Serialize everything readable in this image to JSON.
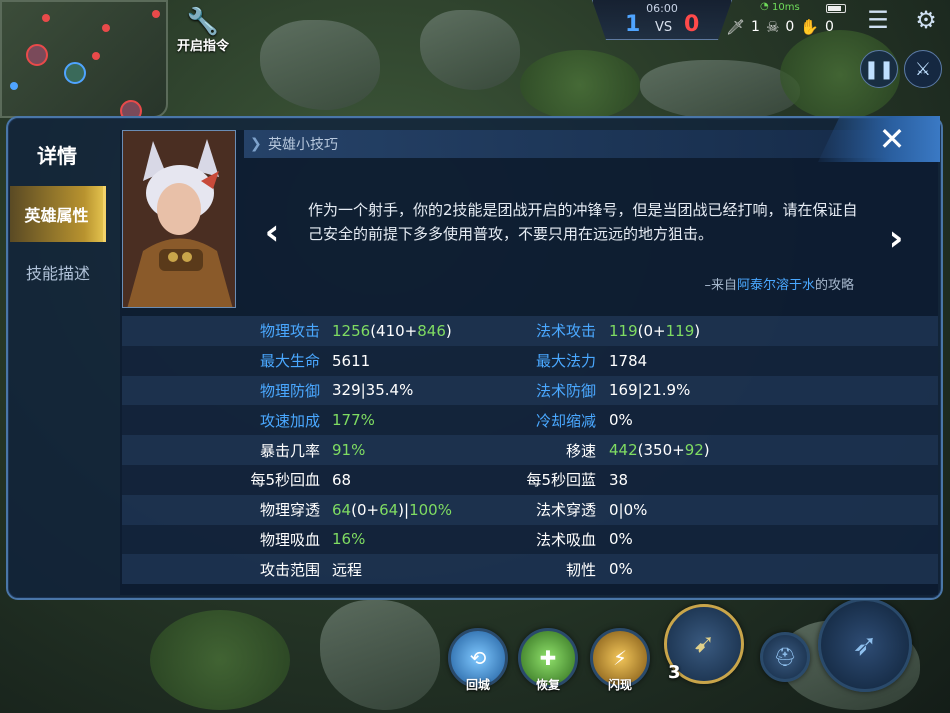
{
  "hud": {
    "command_label": "开启指令",
    "time": "06:00",
    "score_blue": "1",
    "score_vs": "VS",
    "score_red": "0",
    "ping": "10ms",
    "kills": "1",
    "deaths": "0",
    "assists": "0"
  },
  "bottom_skills": {
    "recall": "回城",
    "heal": "恢复",
    "flash": "闪现",
    "ult_level": "3"
  },
  "dialog": {
    "side_title": "详情",
    "tabs": [
      {
        "label": "英雄属性",
        "active": true
      },
      {
        "label": "技能描述",
        "active": false
      }
    ],
    "close_glyph": "✕",
    "tips": {
      "header": "英雄小技巧",
      "text": "作为一个射手，你的2技能是团战开启的冲锋号，但是当团战已经打响，请在保证自己安全的前提下多多使用普攻，不要只用在远远的地方狙击。",
      "source_prefix": "–来自",
      "source_author": "阿泰尔溶于水",
      "source_suffix": "的攻略"
    },
    "stats": [
      {
        "l_label": "物理攻击",
        "l_color": "blue",
        "l_val": [
          {
            "t": "1256",
            "c": "g"
          },
          {
            "t": "(410+",
            "c": "w"
          },
          {
            "t": "846",
            "c": "g"
          },
          {
            "t": ")",
            "c": "w"
          }
        ],
        "r_label": "法术攻击",
        "r_color": "blue",
        "r_val": [
          {
            "t": "119",
            "c": "g"
          },
          {
            "t": "(0+",
            "c": "w"
          },
          {
            "t": "119",
            "c": "g"
          },
          {
            "t": ")",
            "c": "w"
          }
        ]
      },
      {
        "l_label": "最大生命",
        "l_color": "blue",
        "l_val": [
          {
            "t": "5611",
            "c": "w"
          }
        ],
        "r_label": "最大法力",
        "r_color": "blue",
        "r_val": [
          {
            "t": "1784",
            "c": "w"
          }
        ]
      },
      {
        "l_label": "物理防御",
        "l_color": "blue",
        "l_val": [
          {
            "t": "329|35.4%",
            "c": "w"
          }
        ],
        "r_label": "法术防御",
        "r_color": "blue",
        "r_val": [
          {
            "t": "169|21.9%",
            "c": "w"
          }
        ]
      },
      {
        "l_label": "攻速加成",
        "l_color": "blue",
        "l_val": [
          {
            "t": "177%",
            "c": "g"
          }
        ],
        "r_label": "冷却缩减",
        "r_color": "blue",
        "r_val": [
          {
            "t": "0%",
            "c": "w"
          }
        ]
      },
      {
        "l_label": "暴击几率",
        "l_color": "white",
        "l_val": [
          {
            "t": "91%",
            "c": "g"
          }
        ],
        "r_label": "移速",
        "r_color": "white",
        "r_val": [
          {
            "t": "442",
            "c": "g"
          },
          {
            "t": "(350+",
            "c": "w"
          },
          {
            "t": "92",
            "c": "g"
          },
          {
            "t": ")",
            "c": "w"
          }
        ]
      },
      {
        "l_label": "每5秒回血",
        "l_color": "white",
        "l_val": [
          {
            "t": "68",
            "c": "w"
          }
        ],
        "r_label": "每5秒回蓝",
        "r_color": "white",
        "r_val": [
          {
            "t": "38",
            "c": "w"
          }
        ]
      },
      {
        "l_label": "物理穿透",
        "l_color": "white",
        "l_val": [
          {
            "t": "64",
            "c": "g"
          },
          {
            "t": "(0+",
            "c": "w"
          },
          {
            "t": "64",
            "c": "g"
          },
          {
            "t": ")|",
            "c": "w"
          },
          {
            "t": "100%",
            "c": "g"
          }
        ],
        "r_label": "法术穿透",
        "r_color": "white",
        "r_val": [
          {
            "t": "0|0%",
            "c": "w"
          }
        ]
      },
      {
        "l_label": "物理吸血",
        "l_color": "white",
        "l_val": [
          {
            "t": "16%",
            "c": "g"
          }
        ],
        "r_label": "法术吸血",
        "r_color": "white",
        "r_val": [
          {
            "t": "0%",
            "c": "w"
          }
        ]
      },
      {
        "l_label": "攻击范围",
        "l_color": "white",
        "l_val": [
          {
            "t": "远程",
            "c": "w"
          }
        ],
        "r_label": "韧性",
        "r_color": "white",
        "r_val": [
          {
            "t": "0%",
            "c": "w"
          }
        ]
      }
    ]
  },
  "colors": {
    "blue_label": "#4aa8ff",
    "green_value": "#7fdc62",
    "active_tab": "#b8932f",
    "panel_border": "#4a76a8"
  }
}
